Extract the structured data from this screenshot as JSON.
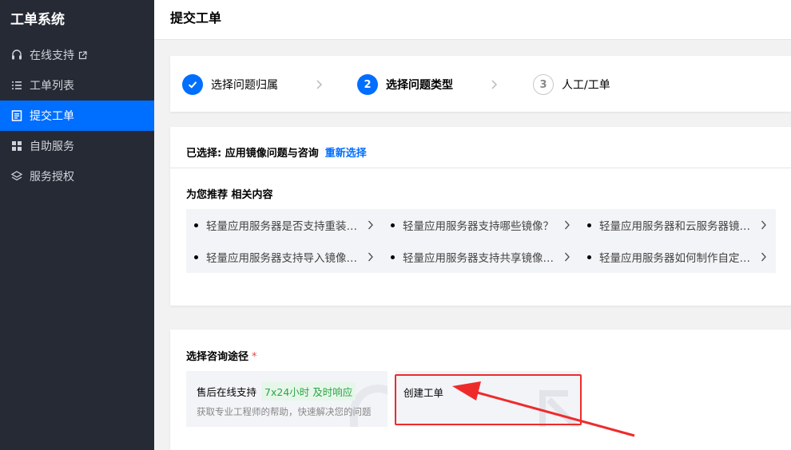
{
  "sidebar": {
    "app_title": "工单系统",
    "items": [
      {
        "label": "在线支持",
        "icon": "headset-icon",
        "external": true
      },
      {
        "label": "工单列表",
        "icon": "list-icon"
      },
      {
        "label": "提交工单",
        "icon": "document-icon",
        "active": true
      },
      {
        "label": "自助服务",
        "icon": "grid-icon"
      },
      {
        "label": "服务授权",
        "icon": "layers-icon"
      }
    ]
  },
  "header": {
    "title": "提交工单"
  },
  "steps": [
    {
      "number": "",
      "label": "选择问题归属",
      "state": "done"
    },
    {
      "number": "2",
      "label": "选择问题类型",
      "state": "current"
    },
    {
      "number": "3",
      "label": "人工/工单",
      "state": "todo"
    }
  ],
  "selected": {
    "prefix": "已选择: 应用镜像问题与咨询",
    "reselect": "重新选择"
  },
  "recommend": {
    "title": "为您推荐 相关内容",
    "items": [
      "轻量应用服务器是否支持重装系统？",
      "轻量应用服务器支持哪些镜像？",
      "轻量应用服务器和云服务器镜像有什么区别？",
      "轻量应用服务器支持导入镜像吗？",
      "轻量应用服务器支持共享镜像吗？",
      "轻量应用服务器如何制作自定义镜像？"
    ]
  },
  "channel": {
    "title": "选择咨询途径",
    "required_mark": "*",
    "online": {
      "title": "售后在线支持",
      "tag": "7x24小时 及时响应",
      "desc": "获取专业工程师的帮助，快速解决您的问题"
    },
    "ticket": {
      "title": "创建工单"
    }
  },
  "colors": {
    "primary": "#006eff",
    "sidebar_bg": "#262a35",
    "highlight": "#ee2b2b",
    "tag_green": "#2ea34b"
  }
}
